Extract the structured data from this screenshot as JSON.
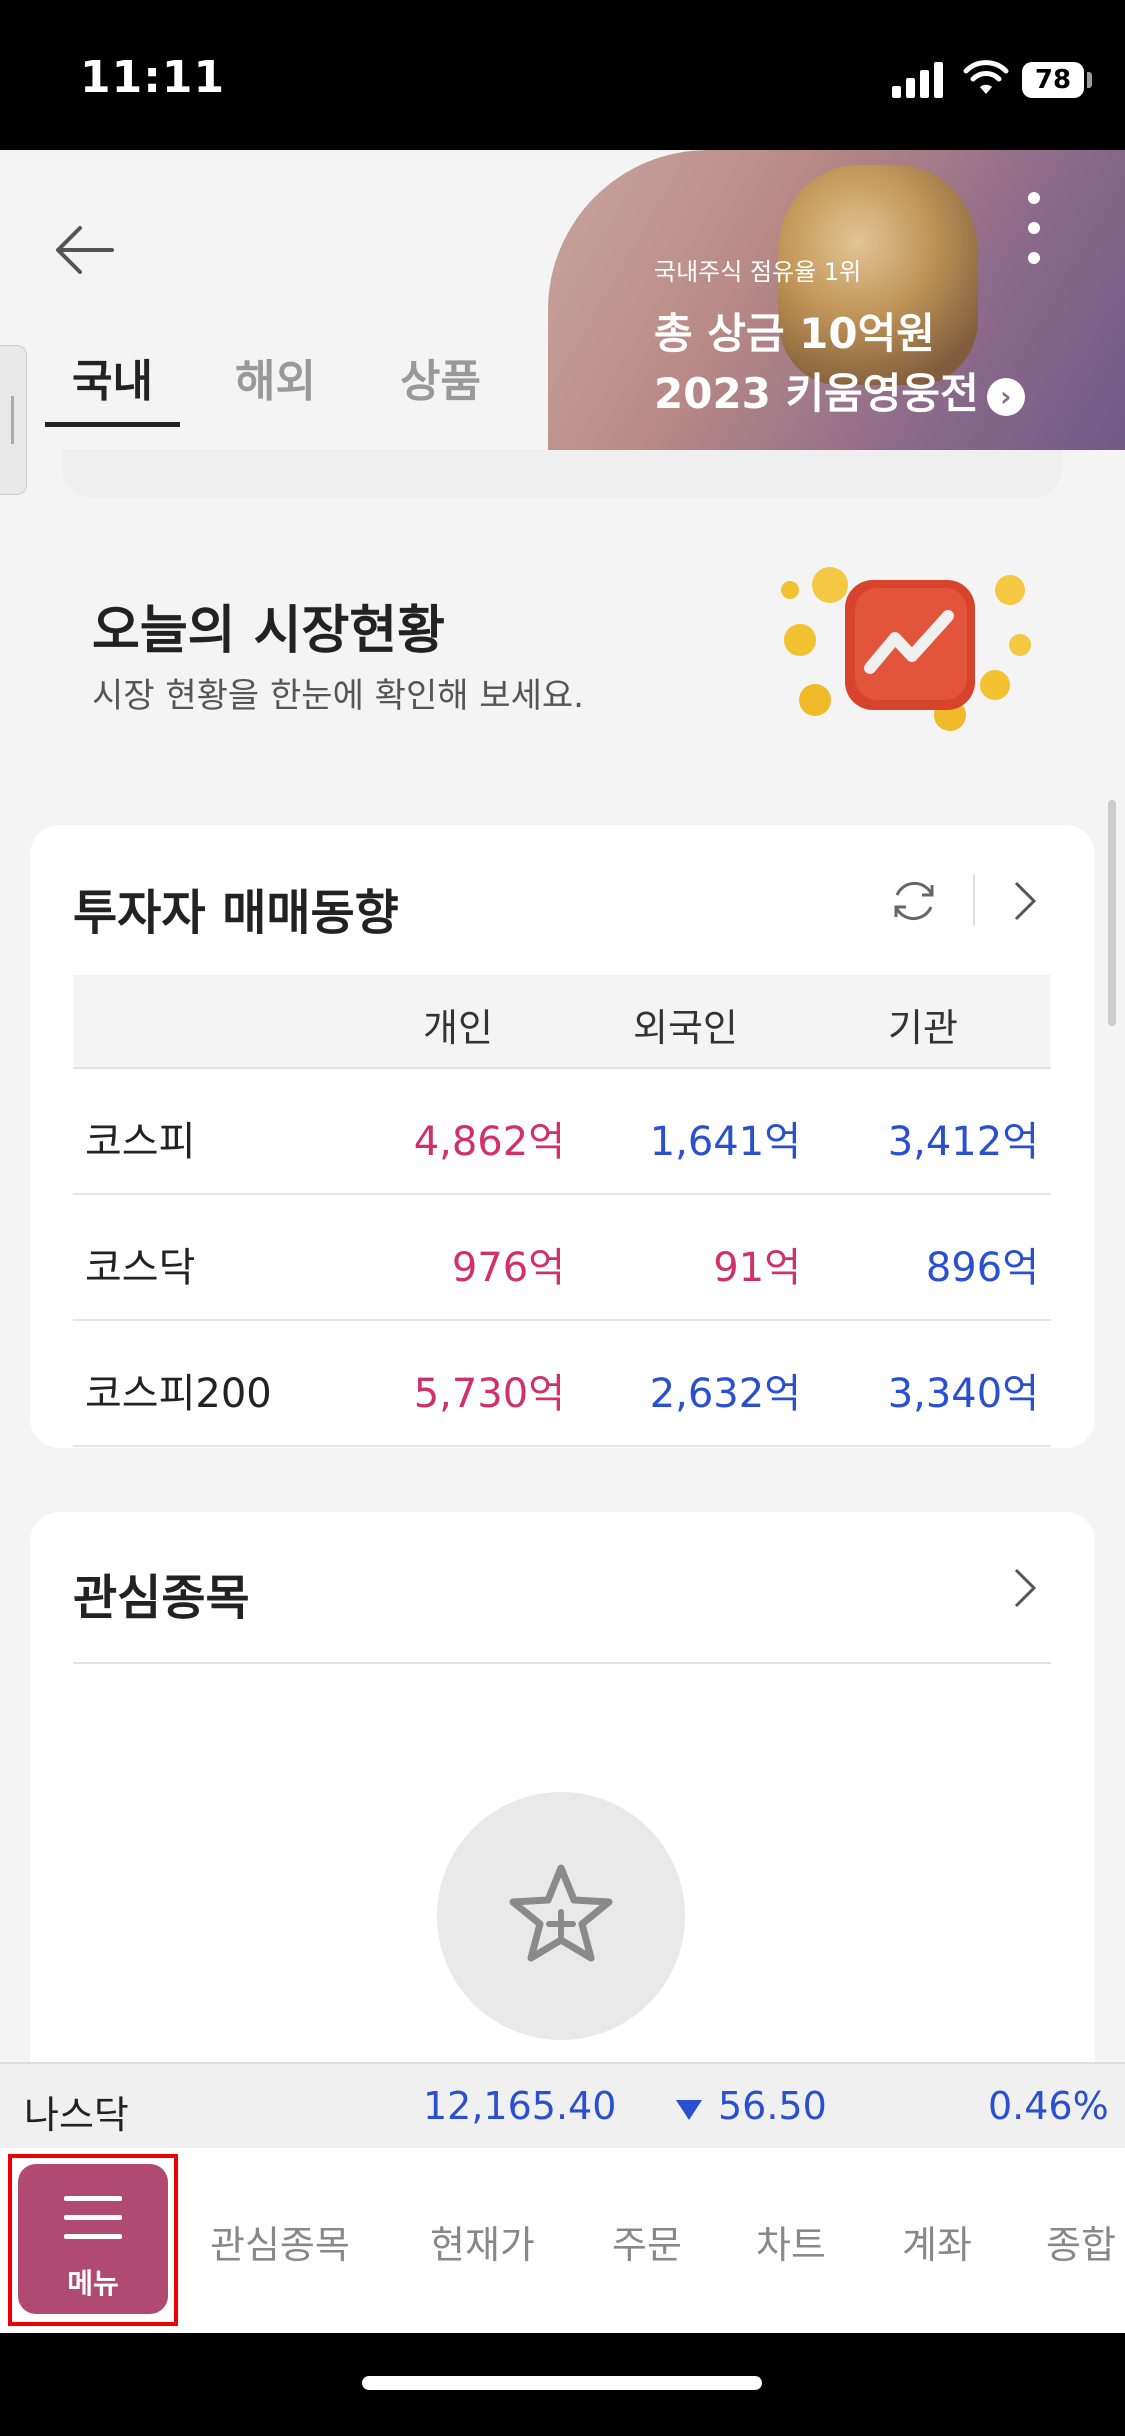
{
  "status_bar": {
    "time": "11:11",
    "battery": "78"
  },
  "header": {
    "tabs": [
      {
        "label": "국내",
        "active": true
      },
      {
        "label": "해외",
        "active": false
      },
      {
        "label": "상품",
        "active": false
      }
    ],
    "banner": {
      "small_text": "국내주식 점유율 1위",
      "line1": "총 상금 10억원",
      "line2": "2023 키움영웅전"
    }
  },
  "market_status": {
    "title": "오늘의 시장현황",
    "subtitle": "시장 현황을 한눈에 확인해 보세요."
  },
  "investor_trend": {
    "title": "투자자 매매동향",
    "columns": [
      "개인",
      "외국인",
      "기관"
    ],
    "rows": [
      {
        "name": "코스피",
        "values": [
          "4,862억",
          "1,641억",
          "3,412억"
        ],
        "colors": [
          "red",
          "blue",
          "blue"
        ]
      },
      {
        "name": "코스닥",
        "values": [
          "976억",
          "91억",
          "896억"
        ],
        "colors": [
          "red",
          "red",
          "blue"
        ]
      },
      {
        "name": "코스피200",
        "values": [
          "5,730억",
          "2,632억",
          "3,340억"
        ],
        "colors": [
          "red",
          "blue",
          "blue"
        ]
      }
    ]
  },
  "watchlist": {
    "title": "관심종목"
  },
  "ticker": {
    "name": "나스닥",
    "price": "12,165.40",
    "change": "56.50",
    "percent": "0.46%"
  },
  "bottom_nav": {
    "menu_label": "메뉴",
    "items": [
      "관심종목",
      "현재가",
      "주문",
      "차트",
      "계좌",
      "종합"
    ]
  },
  "colors": {
    "up": "#d1306a",
    "down": "#2a4fd0",
    "menu": "#b04a72"
  }
}
